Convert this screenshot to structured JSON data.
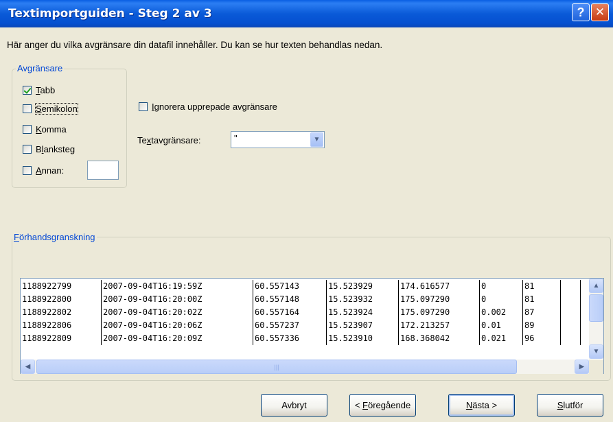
{
  "window": {
    "title": "Textimportguiden - Steg 2 av 3",
    "help": "?",
    "close": "✕"
  },
  "description": "Här anger du vilka avgränsare din datafil innehåller. Du kan se hur texten behandlas nedan.",
  "delimiters": {
    "legend": "Avgränsare",
    "tab": {
      "label": "Tabb",
      "checked": true
    },
    "semicolon": {
      "label": "Semikolon",
      "checked": false
    },
    "comma": {
      "label": "Komma",
      "checked": false
    },
    "space": {
      "label": "Blanksteg",
      "checked": false
    },
    "other": {
      "label": "Annan:",
      "checked": false,
      "value": ""
    }
  },
  "ignore_repeated": {
    "label": "Ignorera upprepade avgränsare",
    "checked": false
  },
  "text_qualifier": {
    "label": "Textavgränsare:",
    "value": "\""
  },
  "preview": {
    "legend": "Förhandsgranskning",
    "rows": [
      [
        "1188922799",
        "2007-09-04T16:19:59Z",
        "60.557143",
        "15.523929",
        "174.616577",
        "0",
        "81",
        ""
      ],
      [
        "1188922800",
        "2007-09-04T16:20:00Z",
        "60.557148",
        "15.523932",
        "175.097290",
        "0",
        "81",
        ""
      ],
      [
        "1188922802",
        "2007-09-04T16:20:02Z",
        "60.557164",
        "15.523924",
        "175.097290",
        "0.002",
        "87",
        ""
      ],
      [
        "1188922806",
        "2007-09-04T16:20:06Z",
        "60.557237",
        "15.523907",
        "172.213257",
        "0.01",
        "89",
        ""
      ],
      [
        "1188922809",
        "2007-09-04T16:20:09Z",
        "60.557336",
        "15.523910",
        "168.368042",
        "0.021",
        "96",
        ""
      ]
    ]
  },
  "buttons": {
    "cancel": "Avbryt",
    "back_pre": "< ",
    "back_key": "F",
    "back_post": "öregående",
    "next_key": "N",
    "next_post": "ästa >",
    "finish_key": "S",
    "finish_post": "lutför"
  }
}
